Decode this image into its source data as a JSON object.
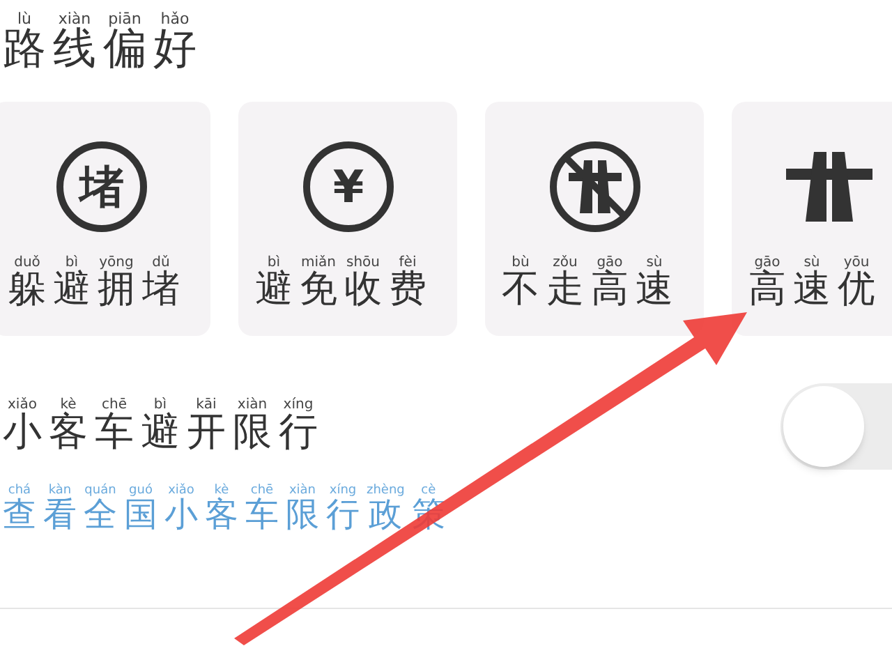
{
  "title": {
    "hanzi": [
      "路",
      "线",
      "偏",
      "好"
    ],
    "pinyin": [
      "lù",
      "xiàn",
      "piān",
      "hǎo"
    ]
  },
  "options": [
    {
      "kind": "avoid-text",
      "glyph": "堵",
      "label": {
        "hanzi": [
          "躲",
          "避",
          "拥",
          "堵"
        ],
        "pinyin": [
          "duǒ",
          "bì",
          "yōng",
          "dǔ"
        ]
      }
    },
    {
      "kind": "avoid-text",
      "glyph": "¥",
      "label": {
        "hanzi": [
          "避",
          "免",
          "收",
          "费"
        ],
        "pinyin": [
          "bì",
          "miǎn",
          "shōu",
          "fèi"
        ]
      }
    },
    {
      "kind": "avoid-highway",
      "label": {
        "hanzi": [
          "不",
          "走",
          "高",
          "速"
        ],
        "pinyin": [
          "bù",
          "zǒu",
          "gāo",
          "sù"
        ]
      }
    },
    {
      "kind": "highway",
      "label": {
        "hanzi": [
          "高",
          "速",
          "优"
        ],
        "pinyin": [
          "gāo",
          "sù",
          "yōu"
        ]
      }
    }
  ],
  "restriction": {
    "label": {
      "hanzi": [
        "小",
        "客",
        "车",
        "避",
        "开",
        "限",
        "行"
      ],
      "pinyin": [
        "xiǎo",
        "kè",
        "chē",
        "bì",
        "kāi",
        "xiàn",
        "xíng"
      ]
    },
    "on": false
  },
  "link": {
    "hanzi": [
      "查",
      "看",
      "全",
      "国",
      "小",
      "客",
      "车",
      "限",
      "行",
      "政",
      "策"
    ],
    "pinyin": [
      "chá",
      "kàn",
      "quán",
      "guó",
      "xiǎo",
      "kè",
      "chē",
      "xiàn",
      "xíng",
      "zhèng",
      "cè"
    ]
  }
}
